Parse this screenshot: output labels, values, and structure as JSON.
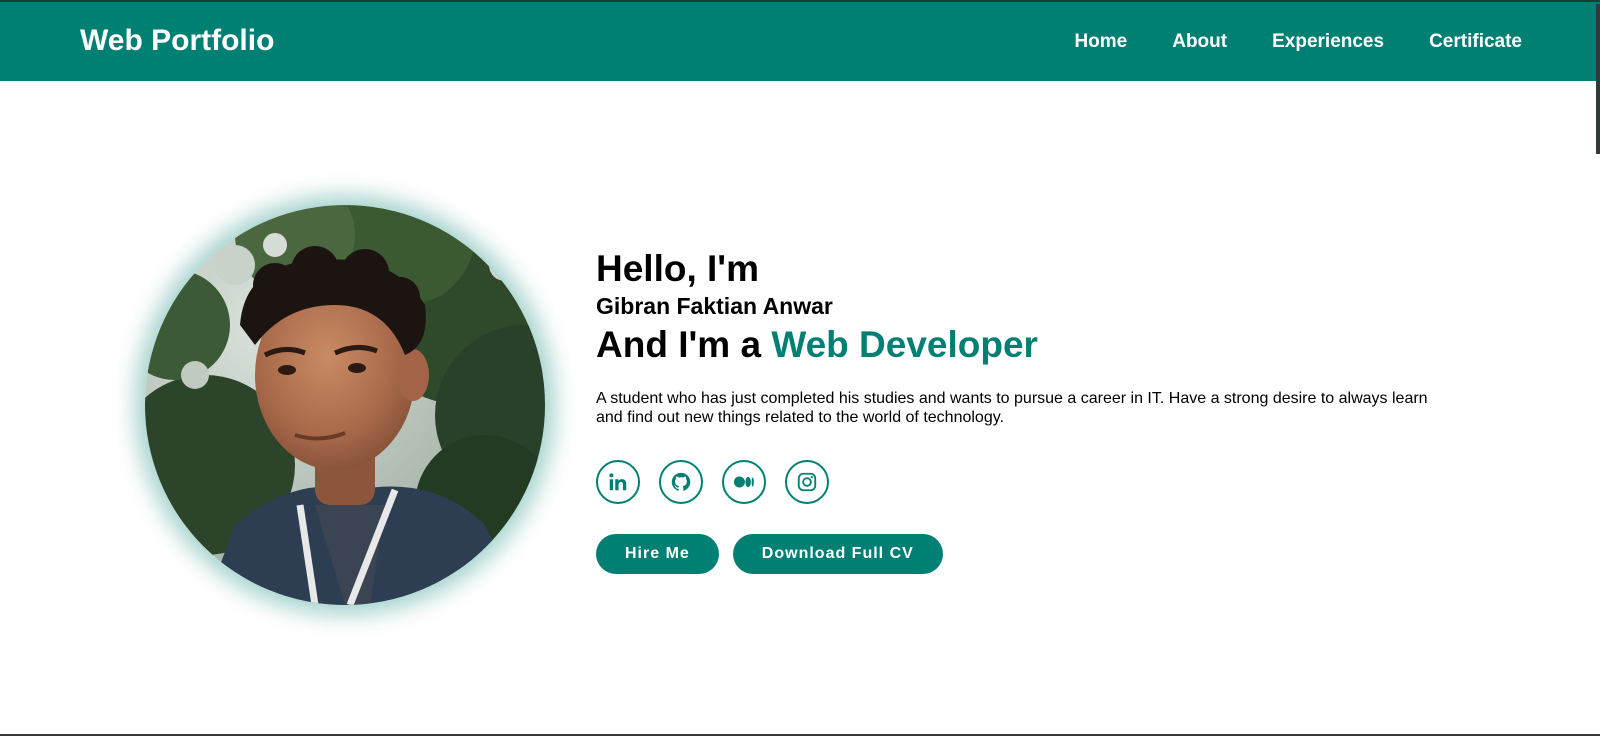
{
  "header": {
    "brand": "Web Portfolio",
    "nav": [
      "Home",
      "About",
      "Experiences",
      "Certificate"
    ]
  },
  "hero": {
    "greeting": "Hello, I'm",
    "name": "Gibran Faktian Anwar",
    "role_prefix": "And I'm a ",
    "role_accent": "Web Developer",
    "description": "A student who has just completed his studies and wants to pursue a career in IT. Have a strong desire to always learn and find out new things related to the world of technology.",
    "socials": [
      "linkedin-icon",
      "github-icon",
      "medium-icon",
      "instagram-icon"
    ],
    "buttons": {
      "hire": "Hire Me",
      "cv": "Download Full CV"
    }
  },
  "colors": {
    "accent": "#008073",
    "text": "#000000",
    "background": "#ffffff"
  }
}
